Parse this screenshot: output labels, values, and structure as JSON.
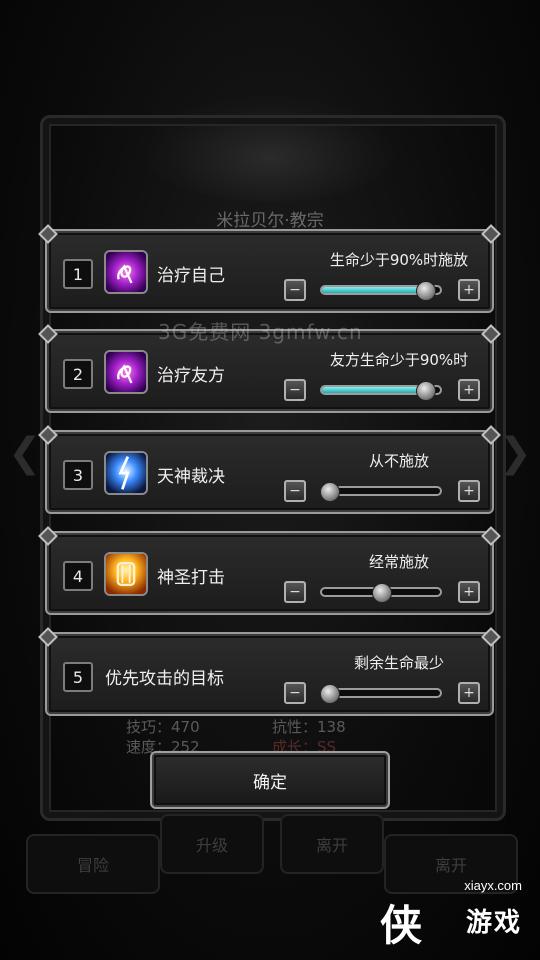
{
  "background": {
    "character_name": "米拉贝尔·教宗",
    "stats": [
      "技巧：470",
      "抗性：138",
      "速度：252",
      "成长：SS"
    ],
    "buttons": [
      "升级",
      "离开",
      "冒险",
      "离开"
    ]
  },
  "watermark": "3G免费网  3gmfw.cn",
  "settings": [
    {
      "index": "1",
      "name": "治疗自己",
      "icon": "heal-self-icon",
      "condition": "生命少于90%时施放",
      "level": 0.92,
      "filled": true
    },
    {
      "index": "2",
      "name": "治疗友方",
      "icon": "heal-ally-icon",
      "condition": "友方生命少于90%时",
      "level": 0.92,
      "filled": true
    },
    {
      "index": "3",
      "name": "天神裁决",
      "icon": "divine-judgment-icon",
      "condition": "从不施放",
      "level": 0.0,
      "filled": false
    },
    {
      "index": "4",
      "name": "神圣打击",
      "icon": "holy-strike-icon",
      "condition": "经常施放",
      "level": 0.5,
      "filled": false
    },
    {
      "index": "5",
      "name": "优先攻击的目标",
      "icon": "",
      "condition": "剩余生命最少",
      "level": 0.0,
      "filled": false
    }
  ],
  "confirm_label": "确定",
  "site_logo": {
    "url": "xiayx.com",
    "brand": "游戏",
    "mark": "侠"
  }
}
